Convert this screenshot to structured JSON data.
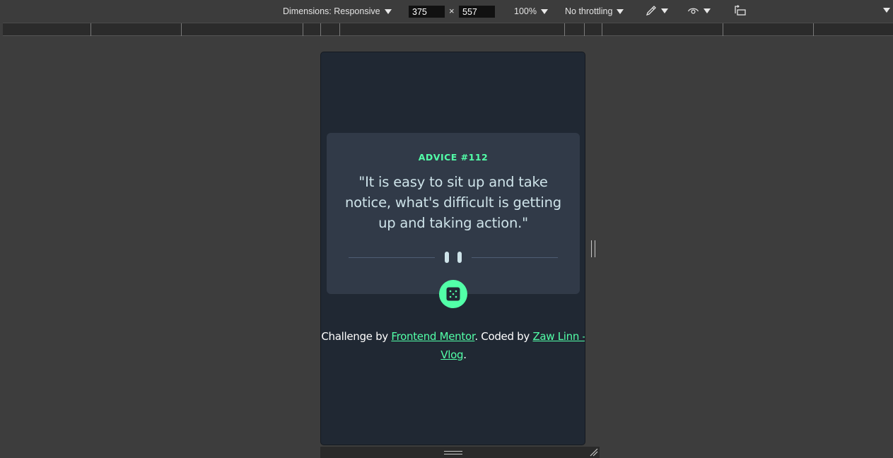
{
  "toolbar": {
    "dimensions_label": "Dimensions: Responsive",
    "width_value": "375",
    "height_value": "557",
    "times": "×",
    "zoom": "100%",
    "throttling": "No throttling",
    "icons": [
      "eyedropper-icon",
      "eye-icon",
      "rotate-icon",
      "more-options-icon"
    ]
  },
  "advice": {
    "label": "ADVICE #112",
    "quote": "\"It is easy to sit up and take notice, what's difficult is getting up and taking action.\""
  },
  "attribution": {
    "prefix": "Challenge by ",
    "link1": "Frontend Mentor",
    "middle": ". Coded by ",
    "link2": "Zaw Linn - Vlog",
    "suffix": "."
  },
  "colors": {
    "accent": "#52ffa8",
    "device_bg": "#202833",
    "card_bg": "#313a48",
    "quote_text": "#cee3e9"
  }
}
